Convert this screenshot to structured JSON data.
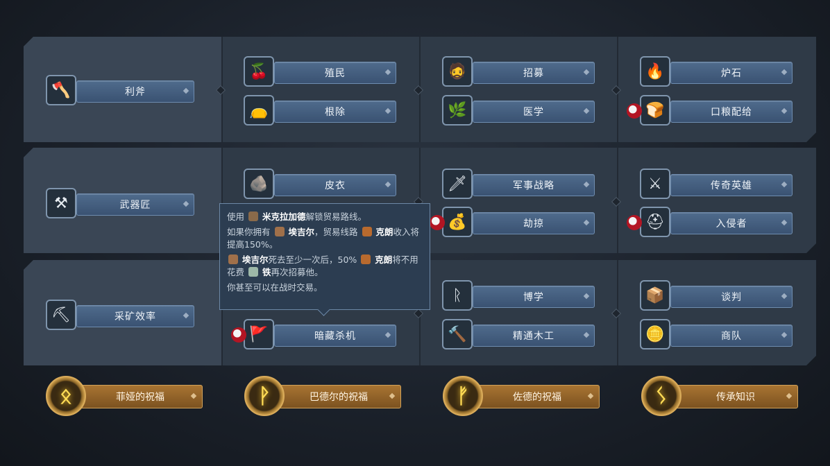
{
  "rows": [
    {
      "first": {
        "label": "利斧",
        "icon": "axe-icon",
        "glyph": "🪓"
      },
      "cols": [
        [
          {
            "label": "殖民",
            "icon": "berries-basket-icon",
            "glyph": "🍒"
          },
          {
            "label": "根除",
            "icon": "sack-icon",
            "glyph": "👝"
          }
        ],
        [
          {
            "label": "招募",
            "icon": "warrior-portrait-icon",
            "glyph": "🧔"
          },
          {
            "label": "医学",
            "icon": "herb-icon",
            "glyph": "🌿"
          }
        ],
        [
          {
            "label": "炉石",
            "icon": "campfire-icon",
            "glyph": "🔥"
          },
          {
            "label": "口粮配给",
            "icon": "bread-icon",
            "glyph": "🍞",
            "blood": true
          }
        ]
      ]
    },
    {
      "first": {
        "label": "武器匠",
        "icon": "anvil-icon",
        "glyph": "⚒"
      },
      "cols": [
        [
          {
            "label": "皮衣",
            "icon": "hide-icon",
            "glyph": "🪨"
          },
          {
            "label": "",
            "icon": "hidden-icon",
            "glyph": ""
          }
        ],
        [
          {
            "label": "军事战略",
            "icon": "sword-icon",
            "glyph": "🗡"
          },
          {
            "label": "劫掠",
            "icon": "loot-pile-icon",
            "glyph": "💰",
            "blood": true
          }
        ],
        [
          {
            "label": "传奇英雄",
            "icon": "battle-axe-icon",
            "glyph": "⚔"
          },
          {
            "label": "入侵者",
            "icon": "horned-helmet-icon",
            "glyph": "⛑",
            "blood": true
          }
        ]
      ]
    },
    {
      "first": {
        "label": "采矿效率",
        "icon": "pickaxe-icon",
        "glyph": "⛏"
      },
      "cols": [
        [
          {
            "label": "",
            "icon": "hidden-icon",
            "glyph": ""
          },
          {
            "label": "暗藏杀机",
            "icon": "banner-icon",
            "glyph": "🚩",
            "blood": true
          }
        ],
        [
          {
            "label": "博学",
            "icon": "rune-stone-icon",
            "glyph": "ᚱ"
          },
          {
            "label": "精通木工",
            "icon": "hammer-icon",
            "glyph": "🔨"
          }
        ],
        [
          {
            "label": "谈判",
            "icon": "crate-icon",
            "glyph": "📦"
          },
          {
            "label": "商队",
            "icon": "trade-icon",
            "glyph": "🪙"
          }
        ]
      ]
    }
  ],
  "blessings": [
    {
      "label": "菲娅的祝福",
      "rune": "ᛟ",
      "icon": "othala-rune-icon"
    },
    {
      "label": "巴德尔的祝福",
      "rune": "ᚹ",
      "icon": "wunjo-rune-icon"
    },
    {
      "label": "佐德的祝福",
      "rune": "ᚠ",
      "icon": "fehu-rune-icon"
    },
    {
      "label": "传承知识",
      "rune": "ᛊ",
      "icon": "sowilo-rune-icon"
    }
  ],
  "tooltip": {
    "l1_a": "使用",
    "l1_name": "米克拉加德",
    "l1_b": "解锁贸易路线。",
    "l2_a": "如果你拥有",
    "l2_name": "埃吉尔",
    "l2_b": "，贸易线路",
    "l2_res": "克朗",
    "l2_c": "收入将提高150%。",
    "l3_name": "埃吉尔",
    "l3_a": "死去至少一次后，50%",
    "l3_res": "克朗",
    "l3_b": "将不用花费",
    "l3_res2": "铁",
    "l3_c": "再次招募他。",
    "l4": "你甚至可以在战时交易。"
  },
  "colors": {
    "node_bar": "#3f5a7b",
    "blessing_bar": "#93642a",
    "rune_glow": "#ffdc55",
    "blood": "#b31523"
  }
}
